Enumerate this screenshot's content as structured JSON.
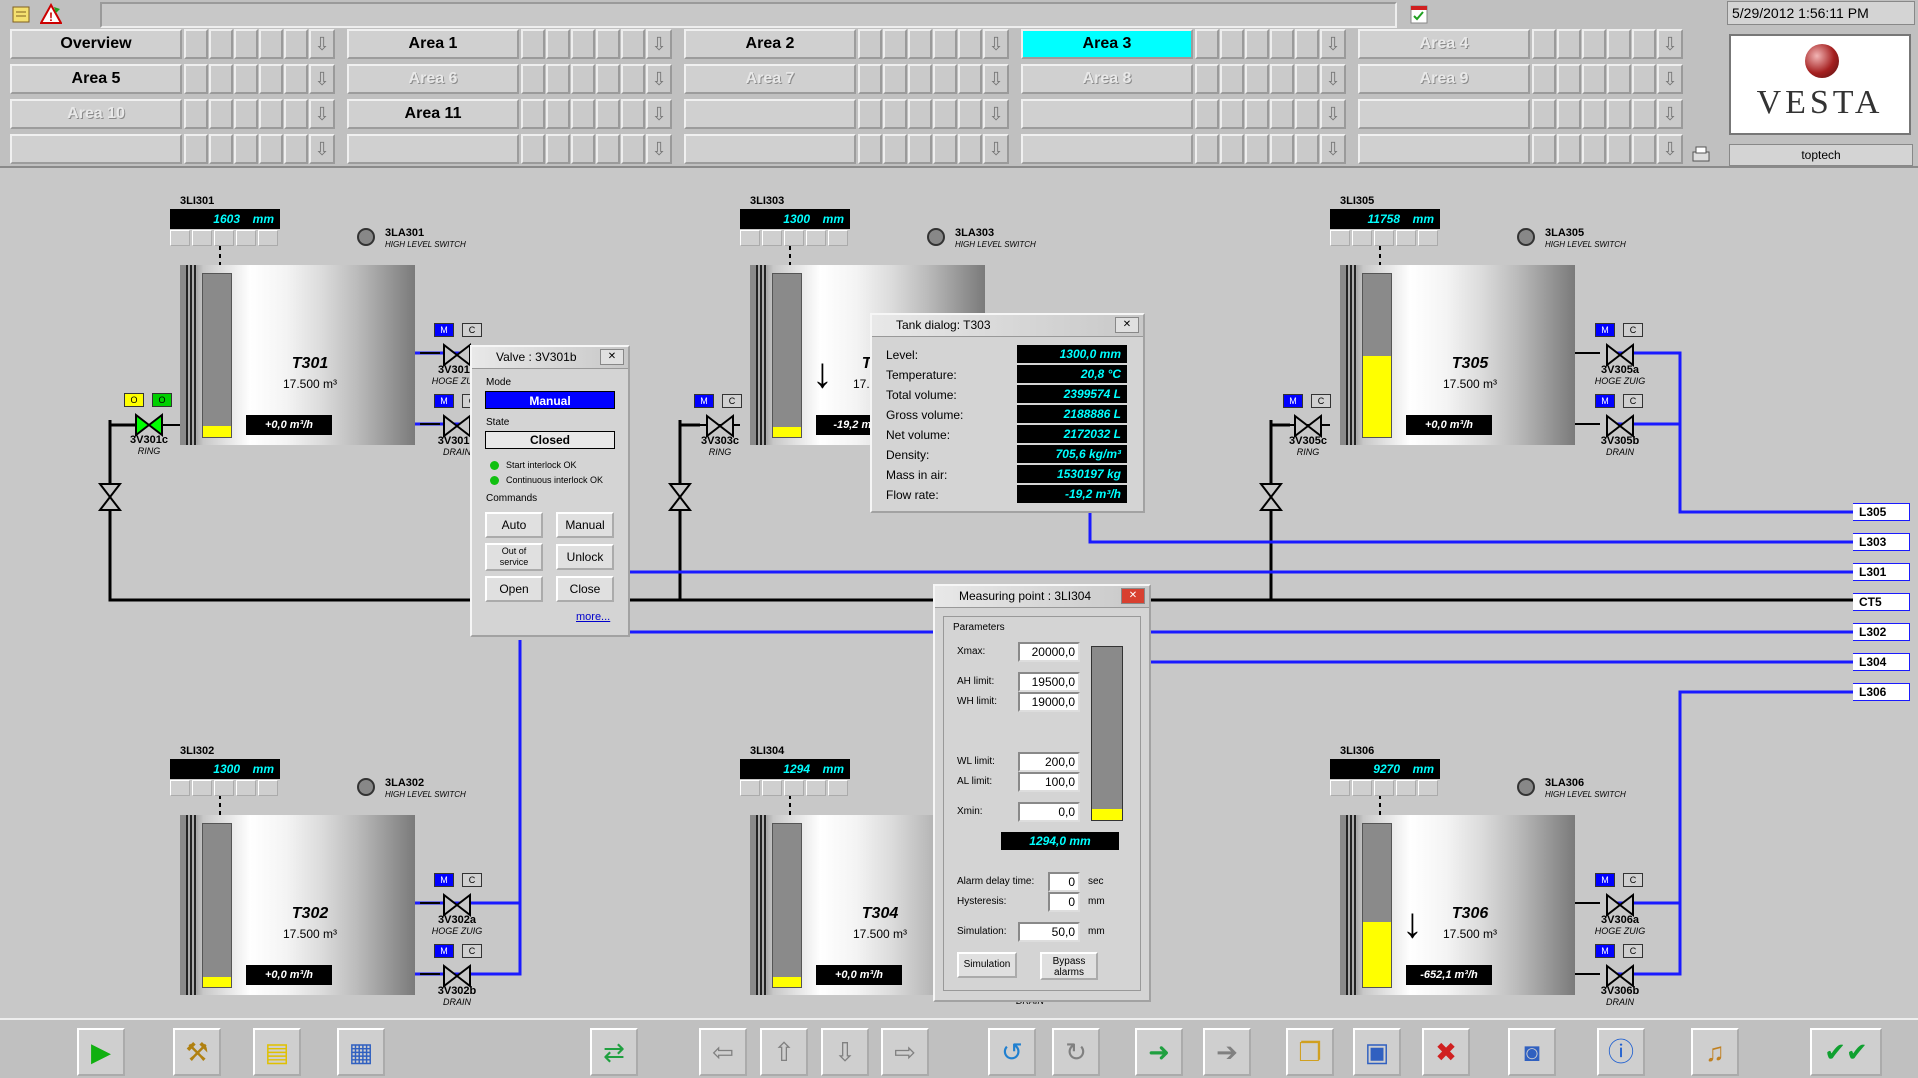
{
  "datetime": "5/29/2012 1:56:11 PM",
  "user": "toptech",
  "logo": "VESTA",
  "areas": [
    {
      "label": "Overview",
      "state": "normal"
    },
    {
      "label": "Area 1",
      "state": "normal"
    },
    {
      "label": "Area 2",
      "state": "normal"
    },
    {
      "label": "Area 3",
      "state": "selected"
    },
    {
      "label": "Area 4",
      "state": "disabled"
    },
    {
      "label": "Area 5",
      "state": "normal"
    },
    {
      "label": "Area 6",
      "state": "disabled"
    },
    {
      "label": "Area 7",
      "state": "disabled"
    },
    {
      "label": "Area 8",
      "state": "disabled"
    },
    {
      "label": "Area 9",
      "state": "disabled"
    },
    {
      "label": "Area 10",
      "state": "disabled"
    },
    {
      "label": "Area 11",
      "state": "normal"
    },
    {
      "label": "",
      "state": "disabled"
    },
    {
      "label": "",
      "state": "disabled"
    },
    {
      "label": "",
      "state": "disabled"
    },
    {
      "label": "",
      "state": "disabled"
    },
    {
      "label": "",
      "state": "disabled"
    },
    {
      "label": "",
      "state": "disabled"
    },
    {
      "label": "",
      "state": "disabled"
    },
    {
      "label": "",
      "state": "disabled"
    }
  ],
  "tanks": {
    "t301": {
      "tag": "3LI301",
      "level": "1603",
      "unit": "mm",
      "switch": "3LA301",
      "switch_desc": "HIGH LEVEL SWITCH",
      "name": "T301",
      "volume": "17.500 m³",
      "flow": "+0,0 m³/h",
      "fill": 0.07
    },
    "t302": {
      "tag": "3LI302",
      "level": "1300",
      "unit": "mm",
      "switch": "3LA302",
      "switch_desc": "HIGH LEVEL SWITCH",
      "name": "T302",
      "volume": "17.500 m³",
      "flow": "+0,0 m³/h",
      "fill": 0.06
    },
    "t303": {
      "tag": "3LI303",
      "level": "1300",
      "unit": "mm",
      "switch": "3LA303",
      "switch_desc": "HIGH LEVEL SWITCH",
      "name": "T303",
      "volume": "17.500 m³",
      "flow": "-19,2 m³/h",
      "fill": 0.06
    },
    "t304": {
      "tag": "3LI304",
      "level": "1294",
      "unit": "mm",
      "switch": "",
      "switch_desc": "",
      "name": "T304",
      "volume": "17.500 m³",
      "flow": "+0,0 m³/h",
      "fill": 0.06
    },
    "t305": {
      "tag": "3LI305",
      "level": "11758",
      "unit": "mm",
      "switch": "3LA305",
      "switch_desc": "HIGH LEVEL SWITCH",
      "name": "T305",
      "volume": "17.500 m³",
      "flow": "+0,0 m³/h",
      "fill": 0.5
    },
    "t306": {
      "tag": "3LI306",
      "level": "9270",
      "unit": "mm",
      "switch": "3LA306",
      "switch_desc": "HIGH LEVEL SWITCH",
      "name": "T306",
      "volume": "17.500 m³",
      "flow": "-652,1 m³/h",
      "fill": 0.4
    }
  },
  "valves": {
    "v301c": {
      "label": "3V301c",
      "desc": "RING"
    },
    "v301a": {
      "label": "3V301a",
      "desc": "HOGE ZUIG"
    },
    "v301b": {
      "label": "3V301b",
      "desc": "DRAIN"
    },
    "v302a": {
      "label": "3V302a",
      "desc": "HOGE ZUIG"
    },
    "v302b": {
      "label": "3V302b",
      "desc": "DRAIN"
    },
    "v303c": {
      "label": "3V303c",
      "desc": "RING"
    },
    "v305a": {
      "label": "3V305a",
      "desc": "HOGE ZUIG"
    },
    "v305b": {
      "label": "3V305b",
      "desc": "DRAIN"
    },
    "v305c": {
      "label": "3V305c",
      "desc": "RING"
    },
    "v306a": {
      "label": "3V306a",
      "desc": "HOGE ZUIG"
    },
    "v306b": {
      "label": "3V306b",
      "desc": "DRAIN"
    },
    "v304drain": {
      "desc": "DRAIN"
    }
  },
  "mc": {
    "m": "M",
    "c": "C",
    "o": "O"
  },
  "lines": [
    "L305",
    "L303",
    "L301",
    "CT5",
    "L302",
    "L304",
    "L306"
  ],
  "valve_dialog": {
    "title": "Valve : 3V301b",
    "mode_label": "Mode",
    "mode": "Manual",
    "state_label": "State",
    "state": "Closed",
    "interlock1": "Start interlock OK",
    "interlock2": "Continuous interlock OK",
    "commands_label": "Commands",
    "auto": "Auto",
    "manual": "Manual",
    "oos1": "Out of",
    "oos2": "service",
    "unlock": "Unlock",
    "open": "Open",
    "close": "Close",
    "more": "more..."
  },
  "tank_dialog": {
    "title": "Tank dialog: T303",
    "rows": [
      {
        "label": "Level:",
        "value": "1300,0 mm"
      },
      {
        "label": "Temperature:",
        "value": "20,8 °C"
      },
      {
        "label": "Total volume:",
        "value": "2399574 L"
      },
      {
        "label": "Gross volume:",
        "value": "2188886 L"
      },
      {
        "label": "Net volume:",
        "value": "2172032 L"
      },
      {
        "label": "Density:",
        "value": "705,6 kg/m³"
      },
      {
        "label": "Mass in air:",
        "value": "1530197 kg"
      },
      {
        "label": "Flow rate:",
        "value": "-19,2 m³/h"
      }
    ]
  },
  "mp_dialog": {
    "title": "Measuring point : 3LI304",
    "params": "Parameters",
    "xmax_l": "Xmax:",
    "xmax": "20000,0",
    "ah_l": "AH limit:",
    "ah": "19500,0",
    "wh_l": "WH limit:",
    "wh": "19000,0",
    "wl_l": "WL limit:",
    "wl": "200,0",
    "al_l": "AL limit:",
    "al": "100,0",
    "xmin_l": "Xmin:",
    "xmin": "0,0",
    "reading": "1294,0 mm",
    "delay_l": "Alarm delay time:",
    "delay": "0",
    "delay_u": "sec",
    "hyst_l": "Hysteresis:",
    "hyst": "0",
    "hyst_u": "mm",
    "sim_l": "Simulation:",
    "sim": "50,0",
    "sim_u": "mm",
    "sim_btn": "Simulation",
    "bypass1": "Bypass",
    "bypass2": "alarms",
    "fill": 0.065
  }
}
